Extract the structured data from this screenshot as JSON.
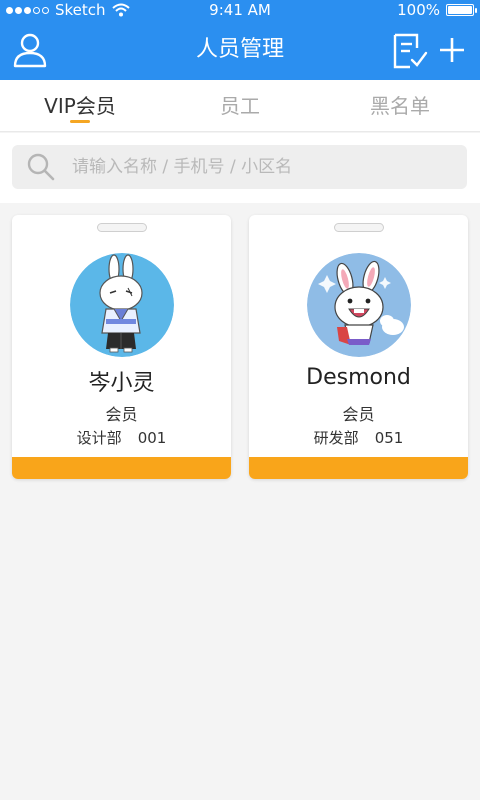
{
  "status_bar": {
    "carrier": "Sketch",
    "time": "9:41 AM",
    "battery": "100%"
  },
  "nav": {
    "title": "人员管理",
    "icons": [
      "user-icon",
      "checklist-icon",
      "plus-icon"
    ]
  },
  "tabs": [
    {
      "label": "VIP会员",
      "active": true
    },
    {
      "label": "员工",
      "active": false
    },
    {
      "label": "黑名单",
      "active": false
    }
  ],
  "search": {
    "placeholder": "请输入名称 / 手机号 / 小区名",
    "value": ""
  },
  "cards": [
    {
      "name": "岑小灵",
      "role": "会员",
      "department": "设计部",
      "id": "001"
    },
    {
      "name": "Desmond",
      "role": "会员",
      "department": "研发部",
      "id": "051"
    }
  ],
  "colors": {
    "header": "#2b8ff0",
    "accent": "#f9a51a",
    "tab_indicator": "#f5a623"
  }
}
